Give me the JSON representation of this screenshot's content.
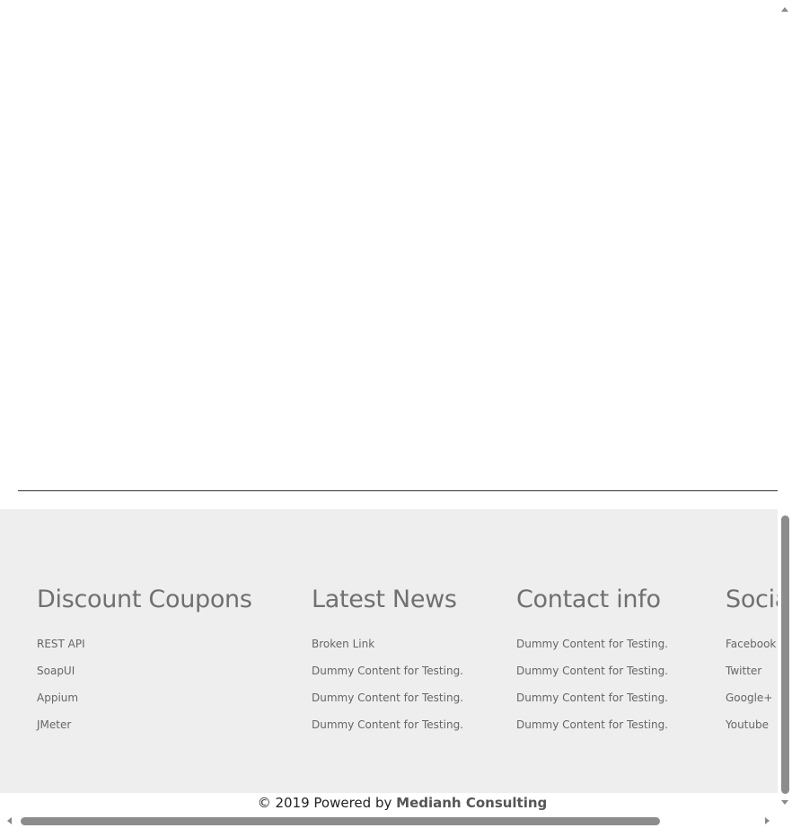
{
  "footer": {
    "columns": [
      {
        "title": "Discount Coupons",
        "links": [
          "REST API",
          "SoapUI",
          "Appium",
          "JMeter"
        ]
      },
      {
        "title": "Latest News",
        "links": [
          "Broken Link",
          "Dummy Content for Testing.",
          "Dummy Content for Testing.",
          "Dummy Content for Testing."
        ]
      },
      {
        "title": "Contact info",
        "links": [
          "Dummy Content for Testing.",
          "Dummy Content for Testing.",
          "Dummy Content for Testing.",
          "Dummy Content for Testing."
        ]
      },
      {
        "title": "Social Media",
        "links": [
          "Facebook",
          "Twitter",
          "Google+",
          "Youtube"
        ]
      }
    ],
    "copyright": {
      "prefix": "© 2019 Powered by",
      "brand": "Medianh Consulting"
    }
  },
  "colors": {
    "footer_bg": "#eeeeee",
    "heading": "#707070",
    "link": "#666666",
    "scrollbar_thumb": "#8c8c8c"
  }
}
